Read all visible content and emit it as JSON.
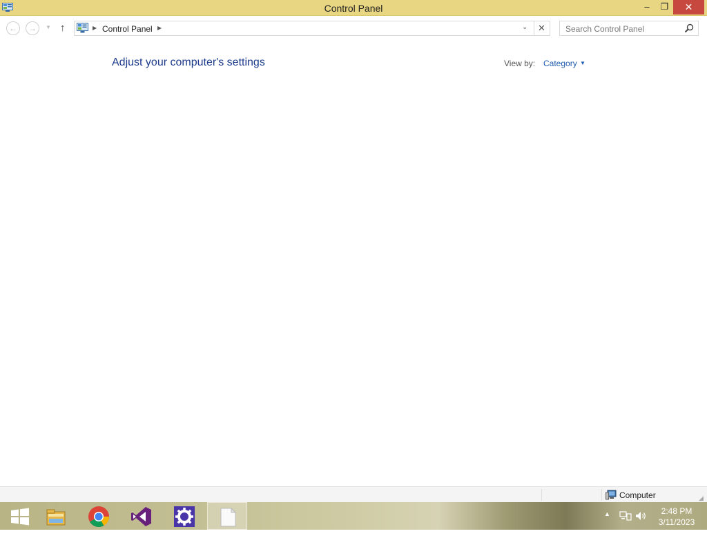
{
  "window": {
    "title": "Control Panel",
    "controls": {
      "minimize": "–",
      "maximize": "❐",
      "close": "✕"
    }
  },
  "nav": {
    "back_icon": "back-arrow-icon",
    "forward_icon": "forward-arrow-icon",
    "up_icon": "up-arrow-icon",
    "breadcrumb": [
      "Control Panel"
    ],
    "search_placeholder": "Search Control Panel"
  },
  "main": {
    "heading": "Adjust your computer's settings",
    "view_by_label": "View by:",
    "view_by_value": "Category"
  },
  "status": {
    "zone": "Computer"
  },
  "taskbar": {
    "items": [
      "start",
      "file-explorer",
      "chrome",
      "visual-studio",
      "settings",
      "notepad"
    ],
    "active_item": "notepad"
  },
  "tray": {
    "time": "2:48 PM",
    "date": "3/11/2023"
  },
  "colors": {
    "titlebar": "#e8d682",
    "close_button": "#c7483e",
    "heading": "#1e3c8c",
    "link": "#1e5bb0"
  }
}
